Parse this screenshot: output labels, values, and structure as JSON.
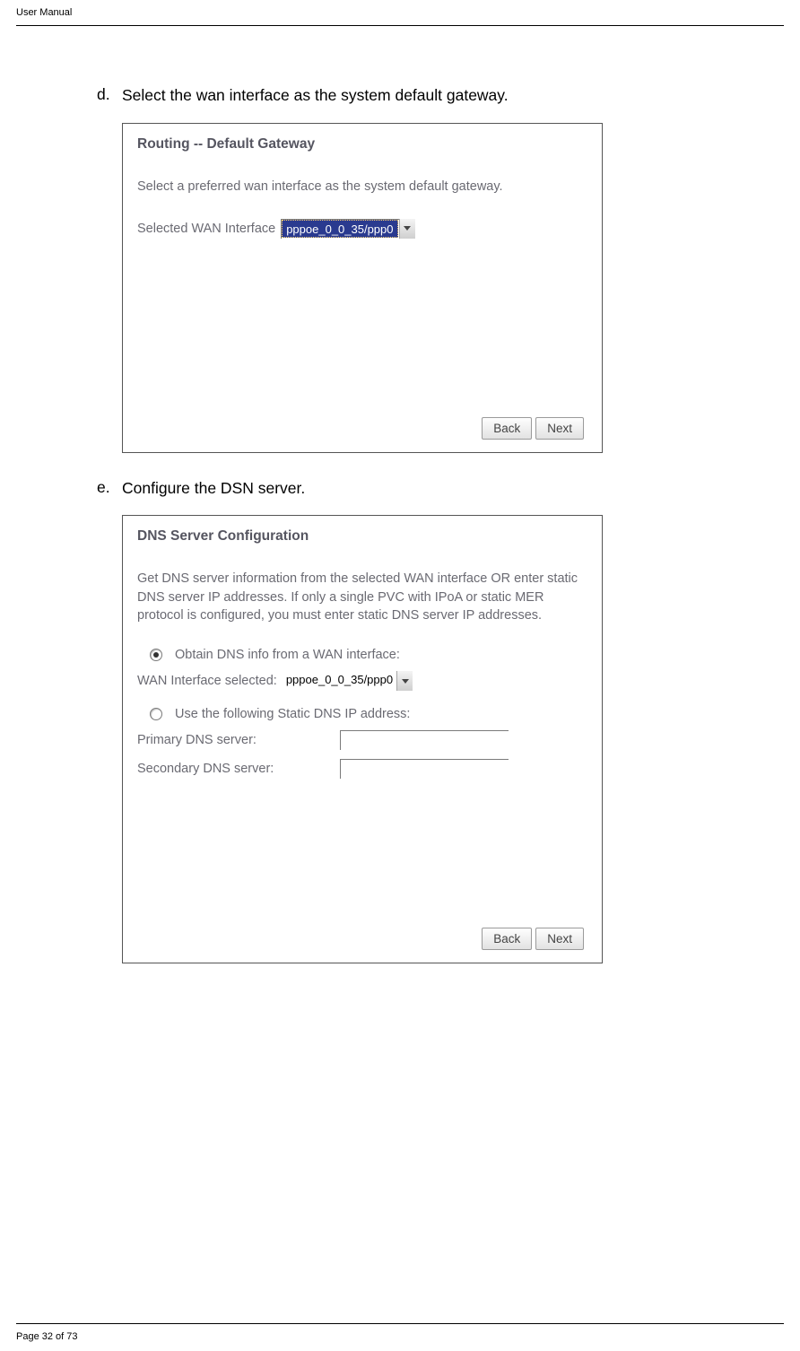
{
  "header": {
    "title": "User Manual"
  },
  "steps": {
    "d": {
      "marker": "d.",
      "text": "Select the wan interface as the system default gateway."
    },
    "e": {
      "marker": "e.",
      "text": "Configure the DSN server."
    }
  },
  "panel1": {
    "title": "Routing -- Default Gateway",
    "desc": "Select a preferred wan interface as the system default gateway.",
    "field_label": "Selected WAN Interface",
    "select_value": "pppoe_0_0_35/ppp0",
    "back": "Back",
    "next": "Next"
  },
  "panel2": {
    "title": "DNS Server Configuration",
    "desc": "Get DNS server information from the selected WAN interface OR enter static DNS server IP addresses. If only a single PVC with IPoA or static MER protocol is configured, you must enter static DNS server IP addresses.",
    "radio_obtain": "Obtain DNS info from a WAN interface:",
    "wan_label": "WAN Interface selected:",
    "wan_value": "pppoe_0_0_35/ppp0",
    "radio_static": "Use the following Static DNS IP address:",
    "primary_label": "Primary DNS server:",
    "primary_value": "",
    "secondary_label": "Secondary DNS server:",
    "secondary_value": "",
    "back": "Back",
    "next": "Next"
  },
  "footer": {
    "text": "Page 32 of 73"
  }
}
